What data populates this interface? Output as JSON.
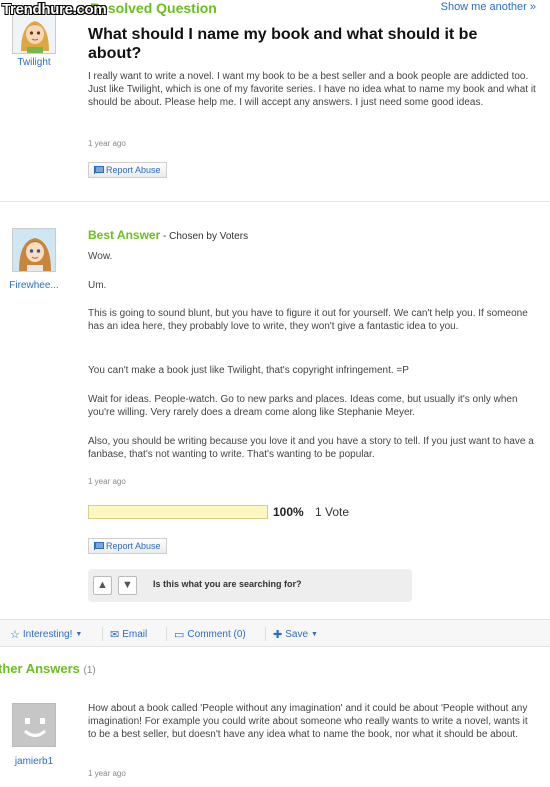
{
  "watermark": "Trendhure.com",
  "header": {
    "resolved_label": "Resolved Question",
    "show_another": "Show me another »"
  },
  "question": {
    "asker": "Twilight",
    "title": "What should I name my book and what should it be about?",
    "body": "I really want to write a novel. I want my book to be a best seller and a book people are addicted too. Just like Twilight, which is one of my favorite series. I have no idea what to name my book and what it should be about. Please help me. I will accept any answers. I just need some good ideas.",
    "time": "1 year ago",
    "report_abuse": "Report Abuse"
  },
  "best_answer": {
    "label": "Best Answer",
    "chosen_by": " - Chosen by Voters",
    "answerer": "Firewhee...",
    "paragraphs": [
      "Wow.",
      "Um.",
      "This is going to sound blunt, but you have to figure it out for yourself. We can't help you. If someone has an idea here, they probably love to write, they won't give a fantastic idea to you.",
      "You can't make a book just like Twilight, that's copyright infringement. =P",
      "Wait for ideas. People-watch. Go to new parks and places. Ideas come, but usually it's only when you're willing. Very rarely does a dream come along like Stephanie Meyer.",
      "Also, you should be writing because you love it and you have a story to tell. If you just want to have a fanbase, that's not wanting to write. That's wanting to be popular."
    ],
    "time": "1 year ago",
    "vote_percent_value": 100,
    "vote_percent": "100%",
    "vote_count": "1 Vote",
    "report_abuse": "Report Abuse",
    "search_prompt": "Is this what you are searching for?"
  },
  "actions": {
    "interesting": "Interesting!",
    "email": "Email",
    "comment": "Comment (0)",
    "save": "Save"
  },
  "other_answers": {
    "heading": "ther Answers",
    "count": "(1)",
    "items": [
      {
        "user": "jamierb1",
        "body": "How about a book called 'People without any imagination' and it could be about 'People without any imagination! For example you could write about someone who really wants to write a novel, wants it to be a best seller, but doesn't have any idea what to name the book, nor what it should be about.",
        "time": "1 year ago"
      }
    ]
  },
  "colors": {
    "green": "#6abf1e",
    "link": "#2b6ec6",
    "vote_fill": "#fdf7c0"
  }
}
